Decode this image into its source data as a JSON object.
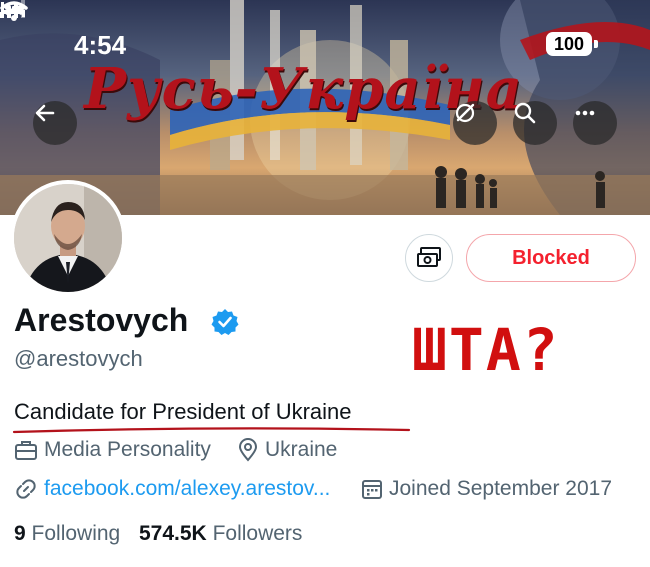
{
  "status_bar": {
    "time": "4:54",
    "battery": "100"
  },
  "banner": {
    "title_text": "Русь-Україна"
  },
  "profile": {
    "display_name": "Arestovych",
    "handle": "@arestovych",
    "bio": "Candidate for President of Ukraine",
    "category": "Media Personality",
    "location": "Ukraine",
    "link": "facebook.com/alexey.arestov...",
    "joined": "Joined September 2017",
    "following_count": "9",
    "following_label": "Following",
    "followers_count": "574.5K",
    "followers_label": "Followers"
  },
  "actions": {
    "blocked_label": "Blocked"
  },
  "overlay": {
    "text": "ШТА?"
  },
  "colors": {
    "accent": "#1d9bf0",
    "blocked": "#f4212e",
    "annotation": "#d10f0f"
  }
}
